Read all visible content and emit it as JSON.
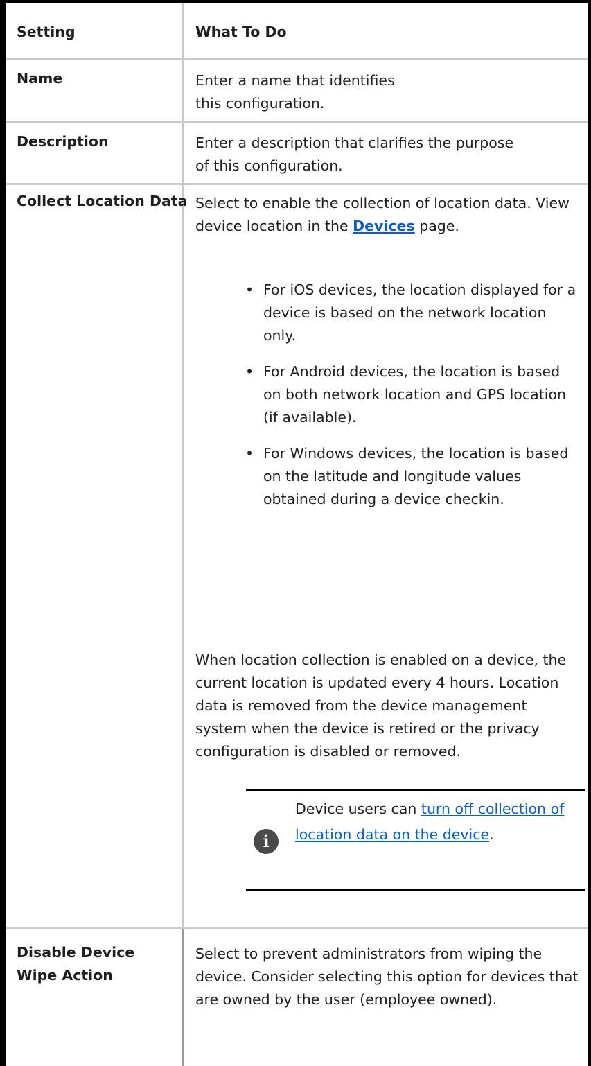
{
  "table": {
    "headers": {
      "setting": "Setting",
      "what_to_do": "What To Do"
    },
    "rows": {
      "name": {
        "label": "Name",
        "desc": "Enter a name that identifies this configuration."
      },
      "description": {
        "label": "Description",
        "desc": "Enter a description that clarifies the purpose of this configuration."
      },
      "collect": {
        "label": "Collect Location Data",
        "intro_pre": "Select to enable the collection of location data. View device location in the",
        "intro_link": "Devices",
        "intro_post": "page.",
        "bullets": [
          "For iOS devices, the location displayed for a device is based on the network location only.",
          "For Android devices, the location is based on both network location and GPS location (if available).",
          "For Windows devices, the location is based on the latitude and longitude values obtained during a device checkin."
        ],
        "paragraph": "When location collection is enabled on a device, the current location is updated every 4 hours. Location data is removed from the device management system when the device is retired or the privacy configuration is disabled or removed.",
        "note_pre": "Device users can",
        "note_link": "turn off collection of location data on the device",
        "note_post": ".",
        "note_icon": "info-icon"
      },
      "wipe": {
        "label": "Disable Device Wipe Action",
        "desc": "Select to prevent administrators from wiping the device. Consider selecting this option for devices that are owned by the user (employee owned)."
      }
    }
  },
  "colors": {
    "link": "#0b5ec9",
    "border": "#c9c9c9",
    "frame": "#000000"
  }
}
